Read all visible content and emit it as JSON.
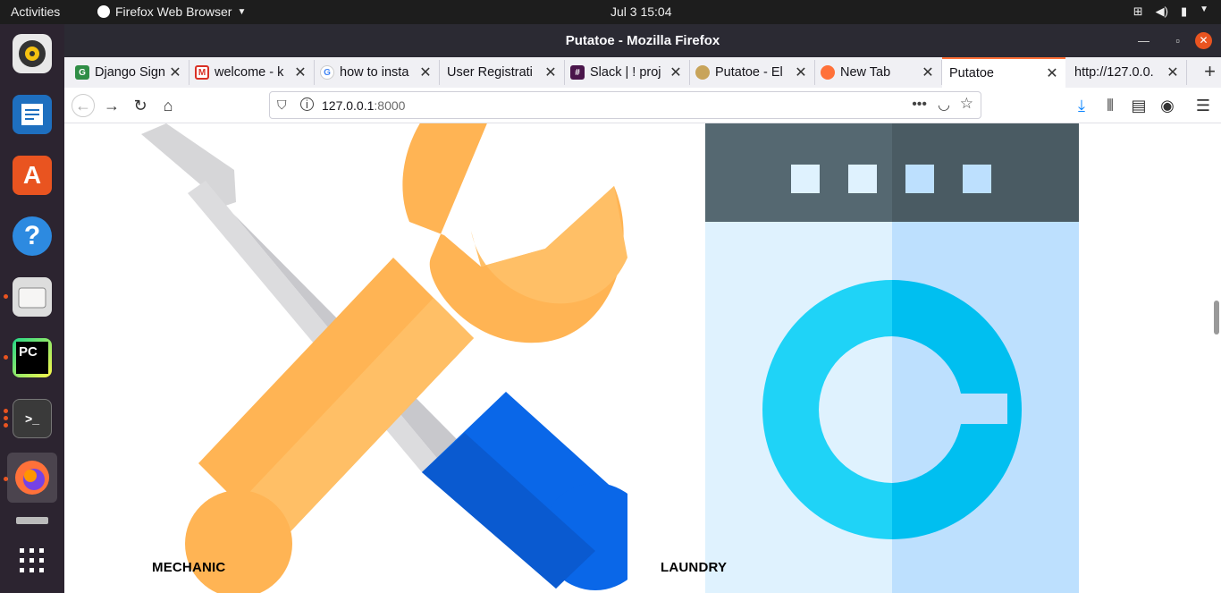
{
  "topbar": {
    "activities": "Activities",
    "app_name": "Firefox Web Browser",
    "clock": "Jul 3  15:04"
  },
  "window": {
    "title": "Putatoe - Mozilla Firefox"
  },
  "tabs": [
    {
      "title": "Django Sign",
      "icon": "geeksforgeeks-icon"
    },
    {
      "title": "welcome - k",
      "icon": "gmail-icon"
    },
    {
      "title": "how to insta",
      "icon": "google-icon"
    },
    {
      "title": "User Registrati",
      "icon": ""
    },
    {
      "title": "Slack | ! proj",
      "icon": "slack-icon"
    },
    {
      "title": "Putatoe - El",
      "icon": "putatoe-icon"
    },
    {
      "title": "New Tab",
      "icon": "firefox-icon"
    },
    {
      "title": "Putatoe",
      "icon": "",
      "selected": true
    },
    {
      "title": "http://127.0.0.",
      "icon": ""
    }
  ],
  "urlbar": {
    "host": "127.0.0.1",
    "port": ":8000"
  },
  "services": [
    {
      "label": "MECHANIC",
      "icon": "wrench-screwdriver-icon"
    },
    {
      "label": "LAUNDRY",
      "icon": "washing-machine-icon"
    }
  ],
  "colors": {
    "wrench": "#ffb454",
    "screwdriver_handle": "#0a67e8",
    "washer_top": "#4e5f68",
    "washer_body": "#dff2fe",
    "washer_drum": "#1fd3f7",
    "accent": "#e95420"
  }
}
